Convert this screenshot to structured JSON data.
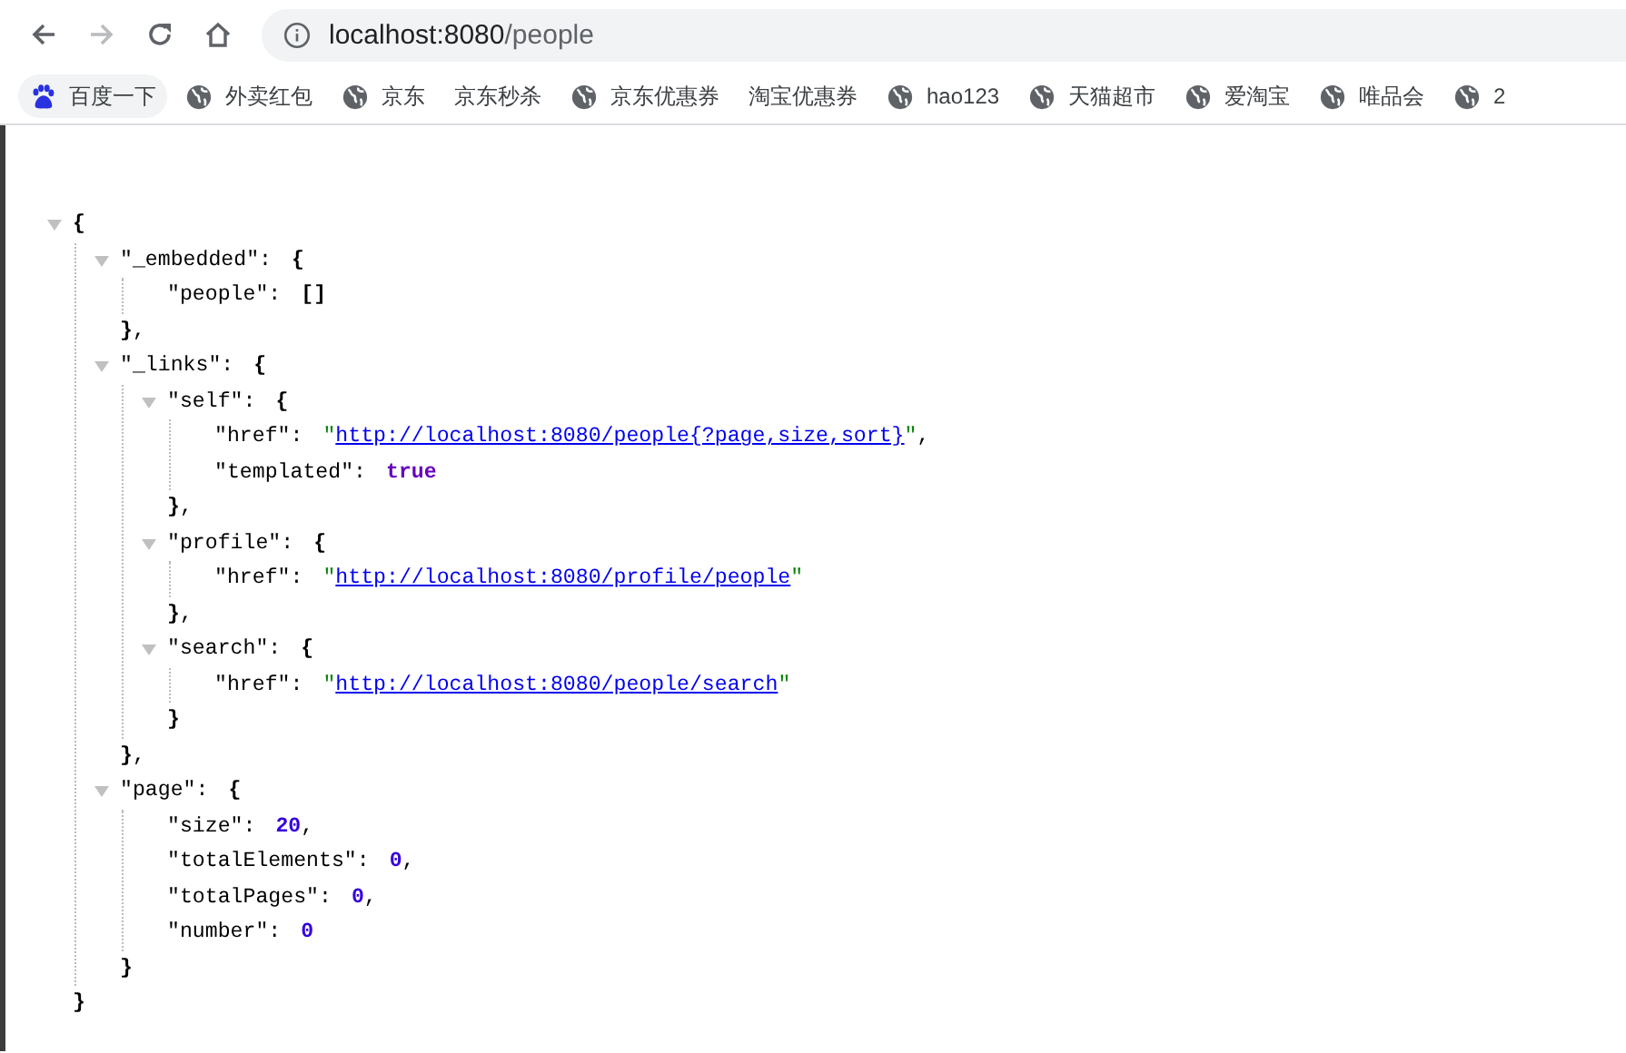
{
  "toolbar": {
    "back": {
      "disabled": false
    },
    "forward": {
      "disabled": true
    },
    "address": {
      "host": "localhost:8080",
      "path": "/people"
    }
  },
  "bookmarks": [
    {
      "label": "百度一下",
      "kind": "paw",
      "hovered": true
    },
    {
      "label": "外卖红包",
      "kind": "globe",
      "hovered": false
    },
    {
      "label": "京东",
      "kind": "globe",
      "hovered": false
    },
    {
      "label": "京东秒杀",
      "kind": "plain",
      "hovered": false
    },
    {
      "label": "京东优惠券",
      "kind": "globe",
      "hovered": false
    },
    {
      "label": "淘宝优惠券",
      "kind": "plain",
      "hovered": false
    },
    {
      "label": "hao123",
      "kind": "globe",
      "hovered": false
    },
    {
      "label": "天猫超市",
      "kind": "globe",
      "hovered": false
    },
    {
      "label": "爱淘宝",
      "kind": "globe",
      "hovered": false
    },
    {
      "label": "唯品会",
      "kind": "globe",
      "hovered": false
    },
    {
      "label": "2",
      "kind": "globe",
      "hovered": false
    }
  ],
  "json_view": {
    "value": [
      {
        "kind": "bracket",
        "text": "{"
      }
    ],
    "expanded": true,
    "close": [
      {
        "kind": "bracket",
        "text": "}"
      }
    ],
    "children": [
      {
        "key": "\"_embedded\":",
        "value": [
          {
            "kind": "bracket",
            "text": "{"
          }
        ],
        "expanded": true,
        "close": [
          {
            "kind": "bracket",
            "text": "}"
          },
          {
            "kind": "punct",
            "text": ","
          }
        ],
        "children": [
          {
            "key": "\"people\":",
            "value": [
              {
                "kind": "bracket",
                "text": "[]"
              }
            ]
          }
        ]
      },
      {
        "key": "\"_links\":",
        "value": [
          {
            "kind": "bracket",
            "text": "{"
          }
        ],
        "expanded": true,
        "close": [
          {
            "kind": "bracket",
            "text": "}"
          },
          {
            "kind": "punct",
            "text": ","
          }
        ],
        "children": [
          {
            "key": "\"self\":",
            "value": [
              {
                "kind": "bracket",
                "text": "{"
              }
            ],
            "expanded": true,
            "close": [
              {
                "kind": "bracket",
                "text": "}"
              },
              {
                "kind": "punct",
                "text": ","
              }
            ],
            "children": [
              {
                "key": "\"href\":",
                "value": [
                  {
                    "kind": "quote",
                    "text": "\""
                  },
                  {
                    "kind": "link",
                    "text": "http://localhost:8080/people{?page,size,sort}"
                  },
                  {
                    "kind": "quote",
                    "text": "\""
                  },
                  {
                    "kind": "punct",
                    "text": ","
                  }
                ]
              },
              {
                "key": "\"templated\":",
                "value": [
                  {
                    "kind": "boolean",
                    "text": "true"
                  }
                ]
              }
            ]
          },
          {
            "key": "\"profile\":",
            "value": [
              {
                "kind": "bracket",
                "text": "{"
              }
            ],
            "expanded": true,
            "close": [
              {
                "kind": "bracket",
                "text": "}"
              },
              {
                "kind": "punct",
                "text": ","
              }
            ],
            "children": [
              {
                "key": "\"href\":",
                "value": [
                  {
                    "kind": "quote",
                    "text": "\""
                  },
                  {
                    "kind": "link",
                    "text": "http://localhost:8080/profile/people"
                  },
                  {
                    "kind": "quote",
                    "text": "\""
                  }
                ]
              }
            ]
          },
          {
            "key": "\"search\":",
            "value": [
              {
                "kind": "bracket",
                "text": "{"
              }
            ],
            "expanded": true,
            "close": [
              {
                "kind": "bracket",
                "text": "}"
              }
            ],
            "children": [
              {
                "key": "\"href\":",
                "value": [
                  {
                    "kind": "quote",
                    "text": "\""
                  },
                  {
                    "kind": "link",
                    "text": "http://localhost:8080/people/search"
                  },
                  {
                    "kind": "quote",
                    "text": "\""
                  }
                ]
              }
            ]
          }
        ]
      },
      {
        "key": "\"page\":",
        "value": [
          {
            "kind": "bracket",
            "text": "{"
          }
        ],
        "expanded": true,
        "close": [
          {
            "kind": "bracket",
            "text": "}"
          }
        ],
        "children": [
          {
            "key": "\"size\":",
            "value": [
              {
                "kind": "number",
                "text": "20"
              },
              {
                "kind": "punct",
                "text": ","
              }
            ]
          },
          {
            "key": "\"totalElements\":",
            "value": [
              {
                "kind": "number",
                "text": "0"
              },
              {
                "kind": "punct",
                "text": ","
              }
            ]
          },
          {
            "key": "\"totalPages\":",
            "value": [
              {
                "kind": "number",
                "text": "0"
              },
              {
                "kind": "punct",
                "text": ","
              }
            ]
          },
          {
            "key": "\"number\":",
            "value": [
              {
                "kind": "number",
                "text": "0"
              }
            ]
          }
        ]
      }
    ]
  }
}
